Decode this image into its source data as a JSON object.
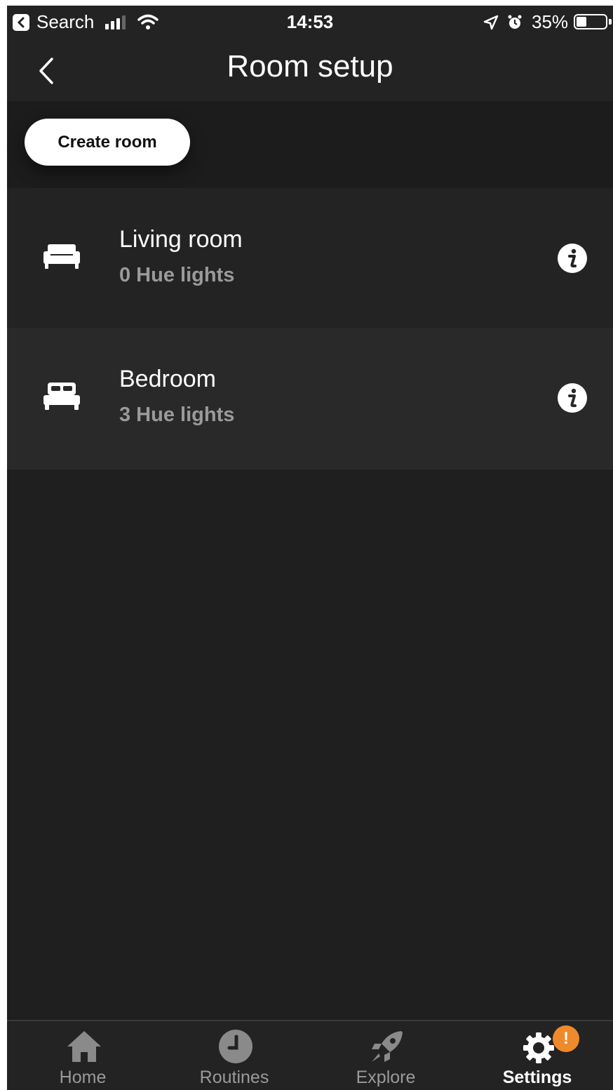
{
  "status_bar": {
    "back_app": "Search",
    "time": "14:53",
    "battery_percent_label": "35%",
    "battery_level": 0.35
  },
  "header": {
    "title": "Room setup",
    "back_icon": "chevron-left-icon"
  },
  "actions": {
    "create_room_label": "Create room"
  },
  "rooms": [
    {
      "name": "Living room",
      "lights": "0 Hue lights",
      "icon": "sofa-icon"
    },
    {
      "name": "Bedroom",
      "lights": "3 Hue lights",
      "icon": "bed-icon"
    }
  ],
  "tabs": [
    {
      "label": "Home",
      "icon": "home-icon",
      "active": false
    },
    {
      "label": "Routines",
      "icon": "clock-icon",
      "active": false
    },
    {
      "label": "Explore",
      "icon": "rocket-icon",
      "active": false
    },
    {
      "label": "Settings",
      "icon": "gear-icon",
      "active": true
    }
  ],
  "settings_badge": "!",
  "colors": {
    "background": "#1f1f1f",
    "header": "#232323",
    "badge": "#ee8a2c",
    "muted_text": "#9a9a9a"
  }
}
